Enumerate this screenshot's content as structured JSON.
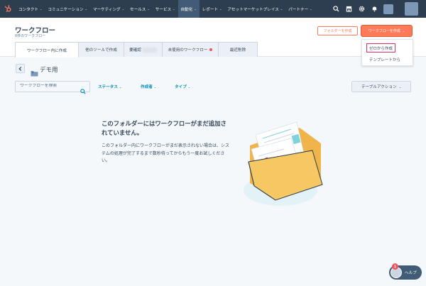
{
  "nav": {
    "items": [
      {
        "label": "コンタクト",
        "chevron": true,
        "active": false
      },
      {
        "label": "コミュニケーション",
        "chevron": true,
        "active": false
      },
      {
        "label": "マーケティング",
        "chevron": true,
        "active": false
      },
      {
        "label": "セールス",
        "chevron": true,
        "active": false
      },
      {
        "label": "サービス",
        "chevron": true,
        "active": false
      },
      {
        "label": "自動化",
        "chevron": true,
        "active": true
      },
      {
        "label": "レポート",
        "chevron": true,
        "active": false
      },
      {
        "label": "アセットマーケットプレイス",
        "chevron": true,
        "active": false
      },
      {
        "label": "パートナー",
        "chevron": true,
        "active": false
      }
    ],
    "icons": [
      "search-icon",
      "marketplace-icon",
      "gear-icon",
      "notifications-icon"
    ]
  },
  "header": {
    "title": "ワークフロー",
    "subtitle": "0件のワークフロー",
    "folder_button": "フォルダーを作成",
    "create_button": "ワークフローを作成"
  },
  "tabs": [
    {
      "label": "ワークフロー内に作成",
      "active": true
    },
    {
      "label": "他のツールで作成",
      "active": false
    },
    {
      "label": "要確認",
      "active": false,
      "blurred": true
    },
    {
      "label": "未使用のワークフロー",
      "active": false,
      "dot": true
    },
    {
      "label": "最近削除",
      "active": false
    }
  ],
  "dropdown": {
    "items": [
      "ゼロから作成",
      "テンプレートから"
    ]
  },
  "folder": {
    "name": "デモ用"
  },
  "filters": {
    "search_placeholder": "ワークフローを検索",
    "status": "ステータス",
    "creator": "作成者",
    "type": "タイプ",
    "table_actions": "テーブルアクション"
  },
  "empty_state": {
    "title": "このフォルダーにはワークフローがまだ追加されていません。",
    "description": "このフォルダー内にワークフローがまだ表示されない場合は、システムの処理が完了するまで数秒待ってからもう一度お試しください。"
  },
  "help": {
    "label": "ヘルプ",
    "badge": "1"
  },
  "colors": {
    "nav_bg": "#2d3e50",
    "accent": "#ff7a59",
    "link": "#0091ae",
    "highlight": "#e0315a"
  }
}
